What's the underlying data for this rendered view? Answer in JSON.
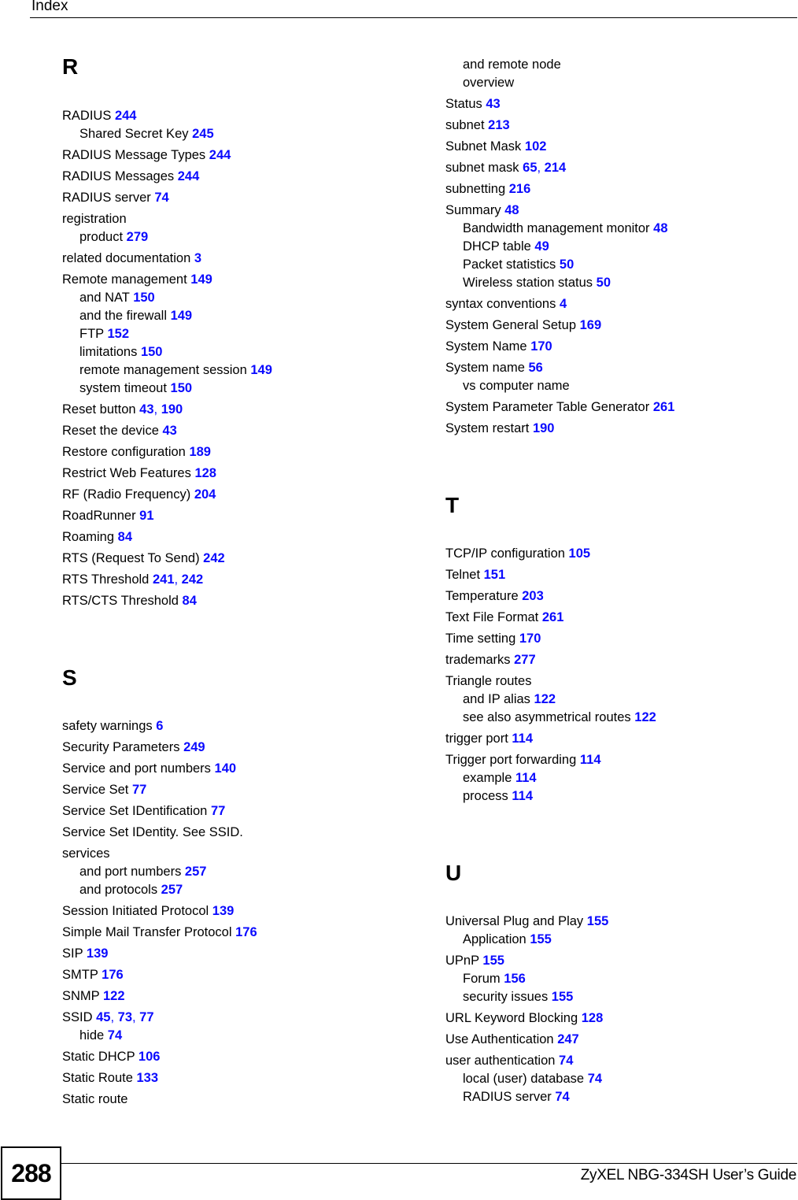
{
  "header": {
    "title": "Index"
  },
  "footer": {
    "page_number": "288",
    "guide_title": "ZyXEL NBG-334SH User’s Guide"
  },
  "colors": {
    "page_link": "#0a0aff",
    "text": "#000000"
  },
  "left_column": {
    "sections": [
      {
        "letter": "R",
        "entries": [
          {
            "term": "RADIUS",
            "pages": [
              "244"
            ],
            "subs": [
              {
                "term": "Shared Secret Key",
                "pages": [
                  "245"
                ]
              }
            ]
          },
          {
            "term": "RADIUS Message Types",
            "pages": [
              "244"
            ],
            "subs": []
          },
          {
            "term": "RADIUS Messages",
            "pages": [
              "244"
            ],
            "subs": []
          },
          {
            "term": "RADIUS server",
            "pages": [
              "74"
            ],
            "subs": []
          },
          {
            "term": "registration",
            "pages": [],
            "subs": [
              {
                "term": "product",
                "pages": [
                  "279"
                ]
              }
            ]
          },
          {
            "term": "related documentation",
            "pages": [
              "3"
            ],
            "subs": []
          },
          {
            "term": "Remote management",
            "pages": [
              "149"
            ],
            "subs": [
              {
                "term": "and NAT",
                "pages": [
                  "150"
                ]
              },
              {
                "term": "and the firewall",
                "pages": [
                  "149"
                ]
              },
              {
                "term": "FTP",
                "pages": [
                  "152"
                ]
              },
              {
                "term": "limitations",
                "pages": [
                  "150"
                ]
              },
              {
                "term": "remote management session",
                "pages": [
                  "149"
                ]
              },
              {
                "term": "system timeout",
                "pages": [
                  "150"
                ]
              }
            ]
          },
          {
            "term": "Reset button",
            "pages": [
              "43",
              "190"
            ],
            "subs": []
          },
          {
            "term": "Reset the device",
            "pages": [
              "43"
            ],
            "subs": []
          },
          {
            "term": "Restore configuration",
            "pages": [
              "189"
            ],
            "subs": []
          },
          {
            "term": "Restrict Web Features",
            "pages": [
              "128"
            ],
            "subs": []
          },
          {
            "term": "RF (Radio Frequency)",
            "pages": [
              "204"
            ],
            "subs": []
          },
          {
            "term": "RoadRunner",
            "pages": [
              "91"
            ],
            "subs": []
          },
          {
            "term": "Roaming",
            "pages": [
              "84"
            ],
            "subs": []
          },
          {
            "term": "RTS (Request To Send)",
            "pages": [
              "242"
            ],
            "subs": []
          },
          {
            "term": "RTS Threshold",
            "pages": [
              "241",
              "242"
            ],
            "subs": []
          },
          {
            "term": "RTS/CTS Threshold",
            "pages": [
              "84"
            ],
            "subs": []
          }
        ]
      },
      {
        "letter": "S",
        "entries": [
          {
            "term": "safety warnings",
            "pages": [
              "6"
            ],
            "subs": []
          },
          {
            "term": "Security Parameters",
            "pages": [
              "249"
            ],
            "subs": []
          },
          {
            "term": "Service and port numbers",
            "pages": [
              "140"
            ],
            "subs": []
          },
          {
            "term": "Service Set",
            "pages": [
              "77"
            ],
            "subs": []
          },
          {
            "term": "Service Set IDentification",
            "pages": [
              "77"
            ],
            "subs": []
          },
          {
            "term": "Service Set IDentity. See SSID.",
            "pages": [],
            "subs": []
          },
          {
            "term": "services",
            "pages": [],
            "subs": [
              {
                "term": "and port numbers",
                "pages": [
                  "257"
                ]
              },
              {
                "term": "and protocols",
                "pages": [
                  "257"
                ]
              }
            ]
          },
          {
            "term": "Session Initiated Protocol",
            "pages": [
              "139"
            ],
            "subs": []
          },
          {
            "term": "Simple Mail Transfer Protocol",
            "pages": [
              "176"
            ],
            "subs": []
          },
          {
            "term": "SIP",
            "pages": [
              "139"
            ],
            "subs": []
          },
          {
            "term": "SMTP",
            "pages": [
              "176"
            ],
            "subs": []
          },
          {
            "term": "SNMP",
            "pages": [
              "122"
            ],
            "subs": []
          },
          {
            "term": "SSID",
            "pages": [
              "45",
              "73",
              "77"
            ],
            "subs": [
              {
                "term": "hide",
                "pages": [
                  "74"
                ]
              }
            ]
          },
          {
            "term": "Static DHCP",
            "pages": [
              "106"
            ],
            "subs": []
          },
          {
            "term": "Static Route",
            "pages": [
              "133"
            ],
            "subs": []
          },
          {
            "term": "Static route",
            "pages": [],
            "subs": []
          }
        ]
      }
    ]
  },
  "right_column": {
    "continued_subs": [
      {
        "term": "and remote node",
        "pages": []
      },
      {
        "term": "overview",
        "pages": []
      }
    ],
    "sections": [
      {
        "letter": "",
        "entries": [
          {
            "term": "Status",
            "pages": [
              "43"
            ],
            "subs": []
          },
          {
            "term": "subnet",
            "pages": [
              "213"
            ],
            "subs": []
          },
          {
            "term": "Subnet Mask",
            "pages": [
              "102"
            ],
            "subs": []
          },
          {
            "term": "subnet mask",
            "pages": [
              "65",
              "214"
            ],
            "subs": []
          },
          {
            "term": "subnetting",
            "pages": [
              "216"
            ],
            "subs": []
          },
          {
            "term": "Summary",
            "pages": [
              "48"
            ],
            "subs": [
              {
                "term": "Bandwidth management monitor",
                "pages": [
                  "48"
                ]
              },
              {
                "term": "DHCP table",
                "pages": [
                  "49"
                ]
              },
              {
                "term": "Packet statistics",
                "pages": [
                  "50"
                ]
              },
              {
                "term": "Wireless station status",
                "pages": [
                  "50"
                ]
              }
            ]
          },
          {
            "term": "syntax conventions",
            "pages": [
              "4"
            ],
            "subs": []
          },
          {
            "term": "System General Setup",
            "pages": [
              "169"
            ],
            "subs": []
          },
          {
            "term": "System Name",
            "pages": [
              "170"
            ],
            "subs": []
          },
          {
            "term": "System name",
            "pages": [
              "56"
            ],
            "subs": [
              {
                "term": "vs computer name",
                "pages": []
              }
            ]
          },
          {
            "term": "System Parameter Table Generator",
            "pages": [
              "261"
            ],
            "subs": []
          },
          {
            "term": "System restart",
            "pages": [
              "190"
            ],
            "subs": []
          }
        ]
      },
      {
        "letter": "T",
        "entries": [
          {
            "term": "TCP/IP configuration",
            "pages": [
              "105"
            ],
            "subs": []
          },
          {
            "term": "Telnet",
            "pages": [
              "151"
            ],
            "subs": []
          },
          {
            "term": "Temperature",
            "pages": [
              "203"
            ],
            "subs": []
          },
          {
            "term": "Text File Format",
            "pages": [
              "261"
            ],
            "subs": []
          },
          {
            "term": "Time setting",
            "pages": [
              "170"
            ],
            "subs": []
          },
          {
            "term": "trademarks",
            "pages": [
              "277"
            ],
            "subs": []
          },
          {
            "term": "Triangle routes",
            "pages": [],
            "subs": [
              {
                "term": "and IP alias",
                "pages": [
                  "122"
                ]
              },
              {
                "term": "see also asymmetrical routes",
                "pages": [
                  "122"
                ]
              }
            ]
          },
          {
            "term": "trigger port",
            "pages": [
              "114"
            ],
            "subs": []
          },
          {
            "term": "Trigger port forwarding",
            "pages": [
              "114"
            ],
            "subs": [
              {
                "term": "example",
                "pages": [
                  "114"
                ]
              },
              {
                "term": "process",
                "pages": [
                  "114"
                ]
              }
            ]
          }
        ]
      },
      {
        "letter": "U",
        "entries": [
          {
            "term": "Universal Plug and Play",
            "pages": [
              "155"
            ],
            "subs": [
              {
                "term": "Application",
                "pages": [
                  "155"
                ]
              }
            ]
          },
          {
            "term": "UPnP",
            "pages": [
              "155"
            ],
            "subs": [
              {
                "term": "Forum",
                "pages": [
                  "156"
                ]
              },
              {
                "term": "security issues",
                "pages": [
                  "155"
                ]
              }
            ]
          },
          {
            "term": "URL Keyword Blocking",
            "pages": [
              "128"
            ],
            "subs": []
          },
          {
            "term": "Use Authentication",
            "pages": [
              "247"
            ],
            "subs": []
          },
          {
            "term": "user authentication",
            "pages": [
              "74"
            ],
            "subs": [
              {
                "term": "local (user) database",
                "pages": [
                  "74"
                ]
              },
              {
                "term": "RADIUS server",
                "pages": [
                  "74"
                ]
              }
            ]
          }
        ]
      }
    ]
  }
}
